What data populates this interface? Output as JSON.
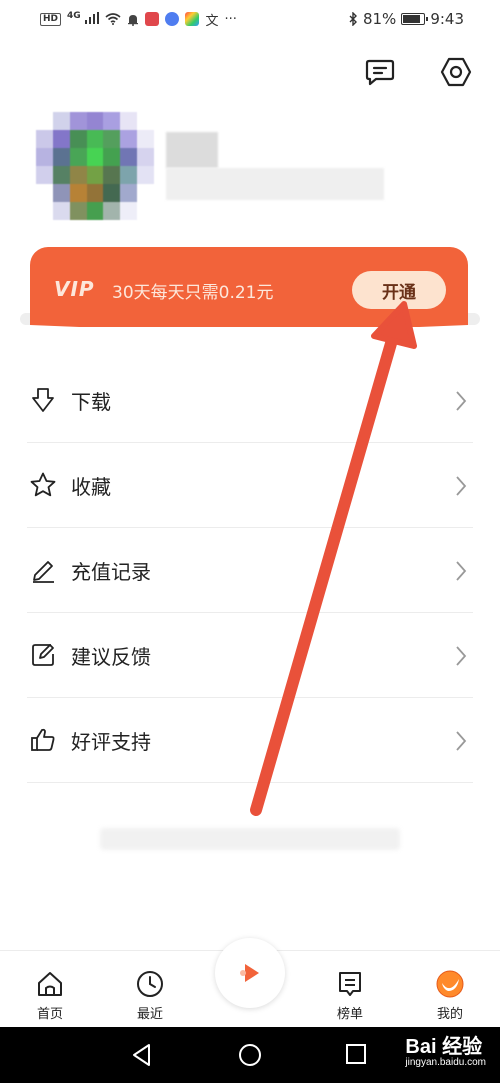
{
  "status_bar": {
    "hd": "HD",
    "network": "4G",
    "battery_text": "81%",
    "battery_level": 0.81,
    "time": "9:43",
    "icons": [
      "signal-icon",
      "wifi-icon",
      "bell-icon",
      "app-icon",
      "app-icon",
      "app-icon",
      "translate-icon",
      "more-icon",
      "bluetooth-icon",
      "battery-icon"
    ]
  },
  "top_actions": [
    "message-icon",
    "settings-icon"
  ],
  "vip": {
    "logo": "VIP",
    "text": "30天每天只需0.21元",
    "button": "开通",
    "color": "#f2633a"
  },
  "menu": [
    {
      "label": "下载",
      "icon": "download-icon"
    },
    {
      "label": "收藏",
      "icon": "star-icon"
    },
    {
      "label": "充值记录",
      "icon": "edit-icon"
    },
    {
      "label": "建议反馈",
      "icon": "feedback-icon"
    },
    {
      "label": "好评支持",
      "icon": "thumbs-up-icon"
    }
  ],
  "tabs": [
    {
      "label": "首页",
      "icon": "home-icon"
    },
    {
      "label": "最近",
      "icon": "clock-icon"
    },
    {
      "label": "榜单",
      "icon": "chart-list-icon"
    },
    {
      "label": "我的",
      "icon": "profile-icon"
    }
  ],
  "watermark": {
    "main": "Bai 经验",
    "sub": "jingyan.baidu.com"
  },
  "accent_color": "#e9513a"
}
